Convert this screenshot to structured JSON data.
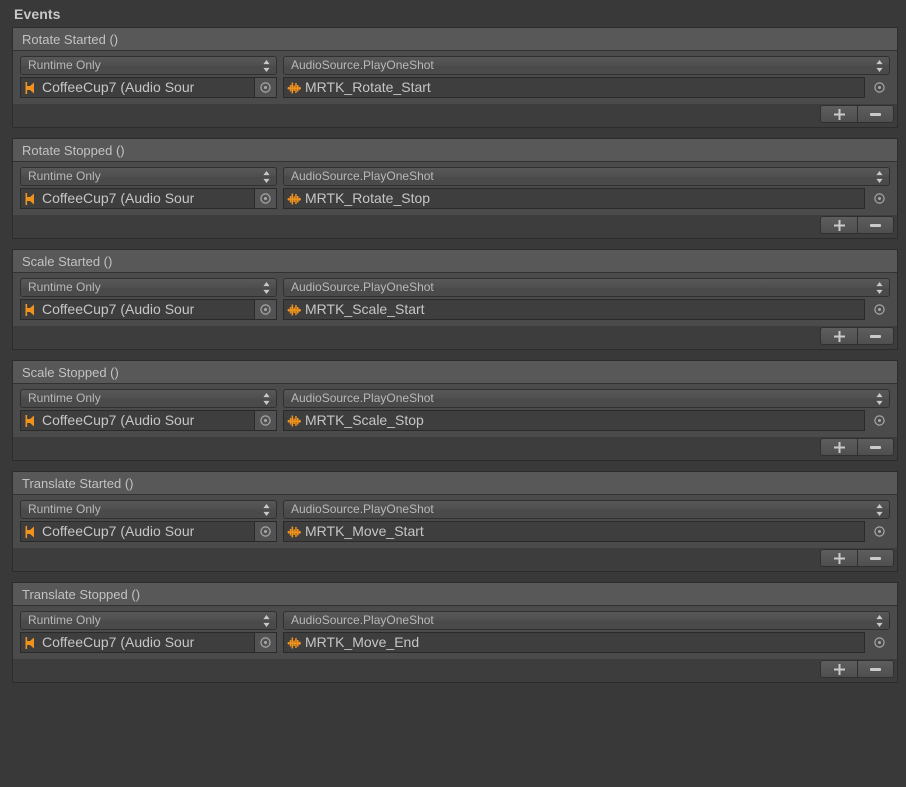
{
  "panel": {
    "title": "Events"
  },
  "icons": {
    "audio_source": "speaker-icon",
    "audio_clip": "waveform-icon",
    "object_picker": "object-picker-icon",
    "popup_arrows": "updown-arrows-icon",
    "add": "plus-icon",
    "remove": "minus-icon"
  },
  "colors": {
    "background": "#393939",
    "header_bar": "#585858",
    "body": "#4b4b4b",
    "field": "#3e3e3e",
    "text": "#c2c2c2",
    "accent_orange": "#f0921e"
  },
  "buttons": {
    "add_label": "+",
    "remove_label": "−"
  },
  "events": [
    {
      "name": "Rotate Started ()",
      "calls": [
        {
          "mode": "Runtime Only",
          "target_object": "CoffeeCup7 (Audio Sour",
          "function": "AudioSource.PlayOneShot",
          "argument": "MRTK_Rotate_Start"
        }
      ]
    },
    {
      "name": "Rotate Stopped ()",
      "calls": [
        {
          "mode": "Runtime Only",
          "target_object": "CoffeeCup7 (Audio Sour",
          "function": "AudioSource.PlayOneShot",
          "argument": "MRTK_Rotate_Stop"
        }
      ]
    },
    {
      "name": "Scale Started ()",
      "calls": [
        {
          "mode": "Runtime Only",
          "target_object": "CoffeeCup7 (Audio Sour",
          "function": "AudioSource.PlayOneShot",
          "argument": "MRTK_Scale_Start"
        }
      ]
    },
    {
      "name": "Scale Stopped ()",
      "calls": [
        {
          "mode": "Runtime Only",
          "target_object": "CoffeeCup7 (Audio Sour",
          "function": "AudioSource.PlayOneShot",
          "argument": "MRTK_Scale_Stop"
        }
      ]
    },
    {
      "name": "Translate Started ()",
      "calls": [
        {
          "mode": "Runtime Only",
          "target_object": "CoffeeCup7 (Audio Sour",
          "function": "AudioSource.PlayOneShot",
          "argument": "MRTK_Move_Start"
        }
      ]
    },
    {
      "name": "Translate Stopped ()",
      "calls": [
        {
          "mode": "Runtime Only",
          "target_object": "CoffeeCup7 (Audio Sour",
          "function": "AudioSource.PlayOneShot",
          "argument": "MRTK_Move_End"
        }
      ]
    }
  ]
}
